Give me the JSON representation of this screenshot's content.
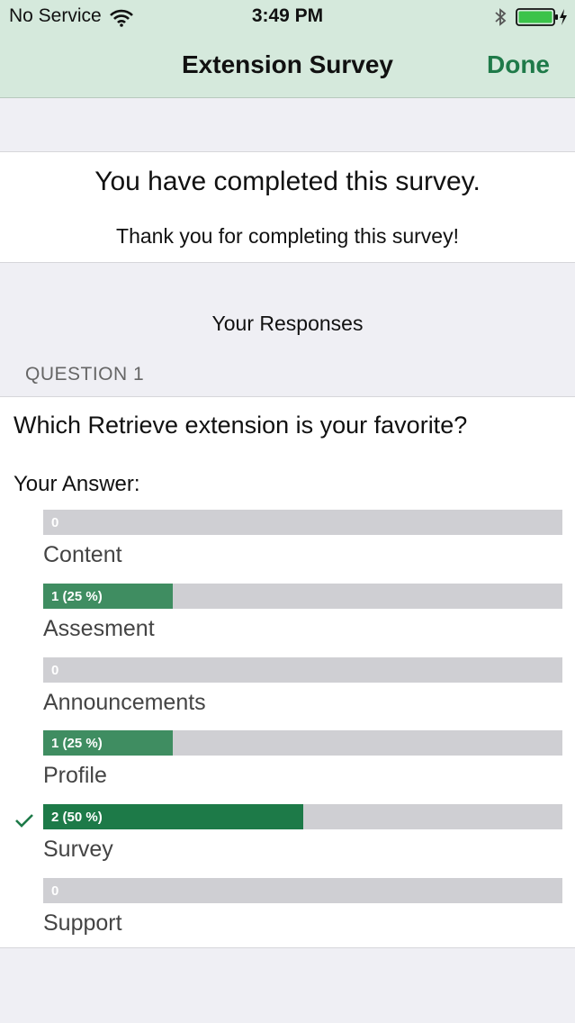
{
  "status_bar": {
    "carrier": "No Service",
    "time": "3:49 PM"
  },
  "nav": {
    "title": "Extension Survey",
    "done_label": "Done"
  },
  "completion": {
    "title": "You have completed this survey.",
    "subtitle": "Thank you for completing this survey!"
  },
  "responses_heading": "Your Responses",
  "question": {
    "label": "QUESTION 1",
    "text": "Which Retrieve extension is your favorite?",
    "answer_label": "Your Answer:"
  },
  "options": [
    {
      "label": "Content",
      "bar_text": "0",
      "fraction": 0,
      "selected": false
    },
    {
      "label": "Assesment",
      "bar_text": "1 (25 %)",
      "fraction": 0.25,
      "selected": false
    },
    {
      "label": "Announcements",
      "bar_text": "0",
      "fraction": 0,
      "selected": false
    },
    {
      "label": "Profile",
      "bar_text": "1 (25 %)",
      "fraction": 0.25,
      "selected": false
    },
    {
      "label": "Survey",
      "bar_text": "2 (50 %)",
      "fraction": 0.5,
      "selected": true
    },
    {
      "label": "Support",
      "bar_text": "0",
      "fraction": 0,
      "selected": false
    }
  ],
  "colors": {
    "accent": "#1f7a49",
    "bar_fill": "#3f8d61",
    "bar_fill_selected": "#1d7a48",
    "bar_track": "#cfcfd3",
    "navbar": "#d5e9dc"
  },
  "icons": {
    "wifi": "wifi-icon",
    "bluetooth": "bluetooth-icon",
    "battery": "battery-charging-icon",
    "check": "checkmark-icon"
  }
}
